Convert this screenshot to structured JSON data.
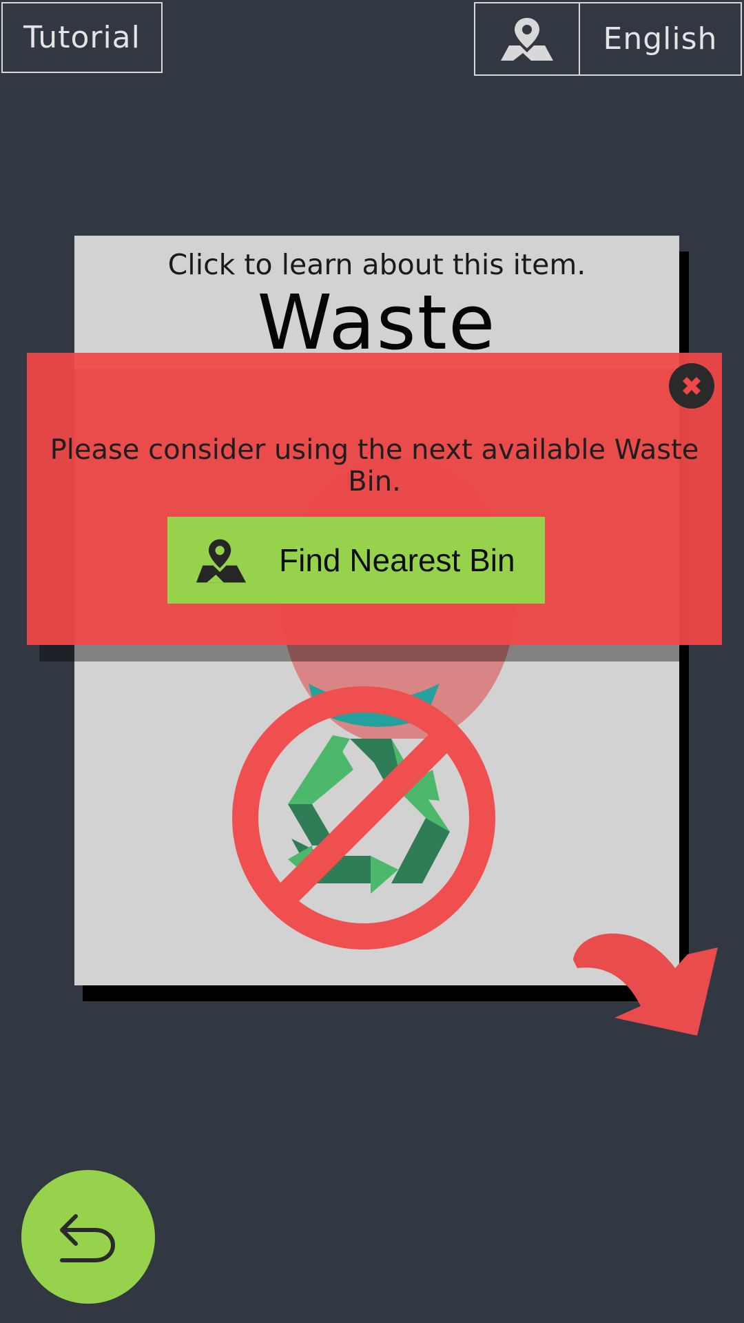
{
  "topbar": {
    "tutorial_label": "Tutorial",
    "map_icon": "map-location-icon",
    "language_label": "English"
  },
  "card": {
    "hint": "Click to learn about this item.",
    "title": "Waste",
    "badge_icon": "no-recycling-icon"
  },
  "alert": {
    "message": "Please consider using the next available Waste Bin.",
    "close_icon": "close-icon",
    "button_label": "Find Nearest Bin",
    "button_icon": "map-location-icon"
  },
  "navigation": {
    "back_icon": "undo-arrow-icon",
    "swipe_icon": "curved-arrow-icon"
  },
  "colors": {
    "background": "#313842",
    "card": "#d2d2d2",
    "alert": "#f04848",
    "accent_green": "#97d24c",
    "prohibit_red": "#ef4f4f",
    "recycle_light": "#4cb86b",
    "recycle_dark": "#2e7d57"
  }
}
